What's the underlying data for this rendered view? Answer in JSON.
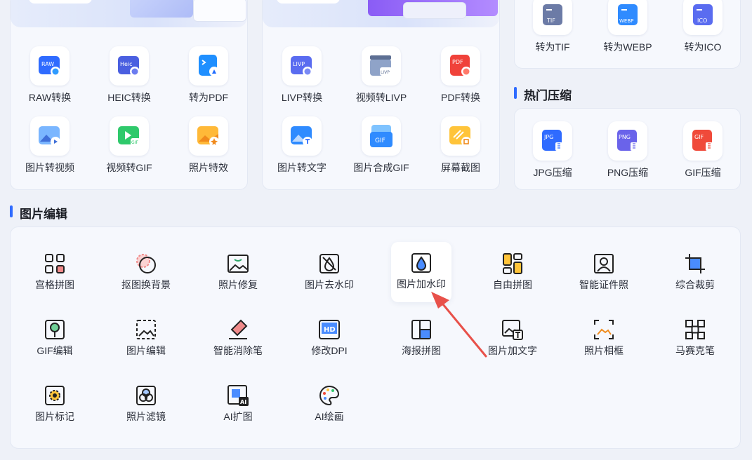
{
  "format_convert_left": {
    "items": [
      {
        "label": "RAW转换",
        "icon": "raw-icon"
      },
      {
        "label": "HEIC转换",
        "icon": "heic-icon"
      },
      {
        "label": "转为PDF",
        "icon": "pdf-convert-icon"
      },
      {
        "label": "图片转视频",
        "icon": "image-to-video-icon"
      },
      {
        "label": "视频转GIF",
        "icon": "video-to-gif-icon"
      },
      {
        "label": "照片特效",
        "icon": "photo-effects-icon"
      }
    ],
    "badges": {
      "raw": "RAW",
      "heic": "Heic",
      "gif": "GIF"
    }
  },
  "format_convert_mid": {
    "items": [
      {
        "label": "LIVP转换",
        "icon": "livp-icon"
      },
      {
        "label": "视频转LIVP",
        "icon": "video-to-livp-icon"
      },
      {
        "label": "PDF转换",
        "icon": "pdf-icon"
      },
      {
        "label": "图片转文字",
        "icon": "image-to-text-icon"
      },
      {
        "label": "图片合成GIF",
        "icon": "gif-compose-icon"
      },
      {
        "label": "屏幕截图",
        "icon": "screenshot-icon"
      }
    ],
    "badges": {
      "livp": "LIVP",
      "pdf": "PDF",
      "gif": "GIF"
    }
  },
  "format_convert_right": {
    "items": [
      {
        "label": "转为TIF",
        "icon": "tif-icon",
        "badge": "TIF"
      },
      {
        "label": "转为WEBP",
        "icon": "webp-icon",
        "badge": "WEBP"
      },
      {
        "label": "转为ICO",
        "icon": "ico-icon",
        "badge": "ICO"
      }
    ]
  },
  "hot_compress": {
    "title": "热门压缩",
    "items": [
      {
        "label": "JPG压缩",
        "badge": "JPG"
      },
      {
        "label": "PNG压缩",
        "badge": "PNG"
      },
      {
        "label": "GIF压缩",
        "badge": "GIF"
      }
    ]
  },
  "image_edit": {
    "title": "图片编辑",
    "items": [
      {
        "label": "宫格拼图"
      },
      {
        "label": "抠图换背景"
      },
      {
        "label": "照片修复"
      },
      {
        "label": "图片去水印"
      },
      {
        "label": "图片加水印",
        "highlighted": true
      },
      {
        "label": "自由拼图"
      },
      {
        "label": "智能证件照"
      },
      {
        "label": "综合裁剪"
      },
      {
        "label": "GIF编辑"
      },
      {
        "label": "图片编辑"
      },
      {
        "label": "智能消除笔"
      },
      {
        "label": "修改DPI"
      },
      {
        "label": "海报拼图"
      },
      {
        "label": "图片加文字"
      },
      {
        "label": "照片相框"
      },
      {
        "label": "马赛克笔"
      },
      {
        "label": "图片标记"
      },
      {
        "label": "照片滤镜"
      },
      {
        "label": "AI扩图"
      },
      {
        "label": "AI绘画"
      }
    ],
    "hd_badge": "HD",
    "ai_badge": "AI"
  },
  "colors": {
    "accent": "#2f6bff",
    "arrow": "#e8514a"
  }
}
